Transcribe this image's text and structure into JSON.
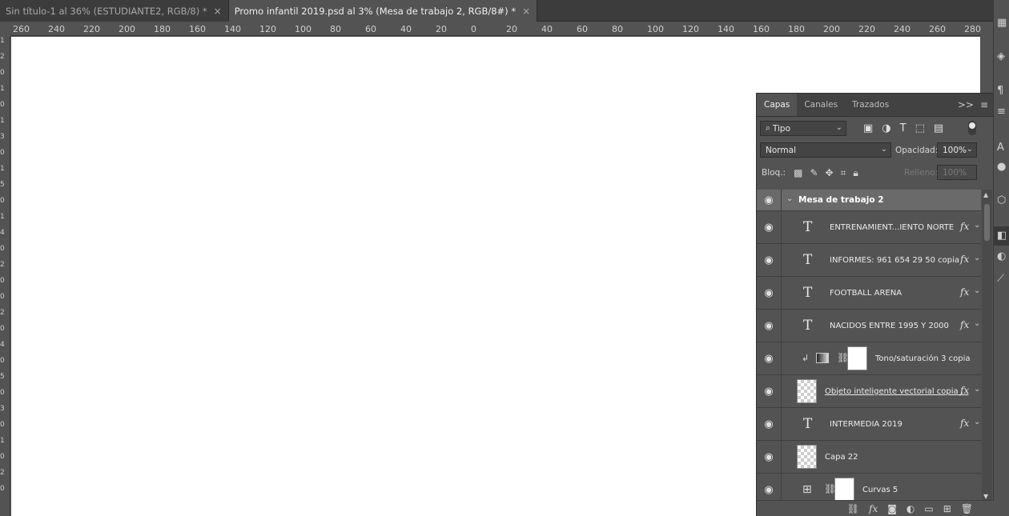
{
  "tabs": [
    {
      "label": "Sin título-1 al 36% (ESTUDIANTE2, RGB/8) *",
      "close": "×"
    },
    {
      "label": "Promo infantil 2019.psd al 3% (Mesa de trabajo 2, RGB/8#) *",
      "close": "×"
    }
  ],
  "ruler": {
    "top_ticks": [
      "260",
      "240",
      "220",
      "200",
      "180",
      "160",
      "140",
      "120",
      "100",
      "80",
      "60",
      "40",
      "20",
      "0",
      "20",
      "40",
      "60",
      "80",
      "100",
      "120",
      "140",
      "160",
      "180",
      "200",
      "220",
      "240",
      "260",
      "280"
    ],
    "left_ticks": [
      "1",
      "2",
      "0",
      "1",
      "0",
      "1",
      "3",
      "0",
      "1",
      "5",
      "0",
      "1",
      "4",
      "0",
      "2",
      "0",
      "0",
      "2",
      "0",
      "4",
      "0",
      "5",
      "0",
      "3",
      "0",
      "1",
      "0",
      "2",
      "0"
    ]
  },
  "panel": {
    "tabs": [
      "Capas",
      "Canales",
      "Trazados"
    ],
    "expand": ">>",
    "filter_kind": "Tipo",
    "blend_mode": "Normal",
    "opacity_label": "Opacidad:",
    "opacity_value": "100%",
    "lock_label": "Bloq.:",
    "fill_label": "Relleno:",
    "fill_value": "100%",
    "layers": [
      {
        "name": "Mesa de trabajo 2",
        "kind": "group"
      },
      {
        "name": "ENTRENAMIENT...IENTO NORTE",
        "kind": "text",
        "fx": "fx"
      },
      {
        "name": "INFORMES: 961 654 29 50 copia",
        "kind": "text",
        "fx": "fx"
      },
      {
        "name": "FOOTBALL ARENA",
        "kind": "text",
        "fx": "fx"
      },
      {
        "name": "NACIDOS ENTRE 1995 Y 2000",
        "kind": "text",
        "fx": "fx"
      },
      {
        "name": "Tono/saturación 3 copia",
        "kind": "adjustment"
      },
      {
        "name": "Objeto inteligente vectorial copia ...",
        "kind": "smart",
        "fx": "fx"
      },
      {
        "name": "INTERMEDIA 2019",
        "kind": "text",
        "fx": "fx"
      },
      {
        "name": "Capa 22",
        "kind": "pixel"
      },
      {
        "name": "Curvas 5",
        "kind": "curves"
      }
    ]
  },
  "colors": {
    "panel_bg": "#535353",
    "tab_bg": "#3c3c3c",
    "canvas": "#ffffff",
    "group_row": "#6a6a6a"
  }
}
